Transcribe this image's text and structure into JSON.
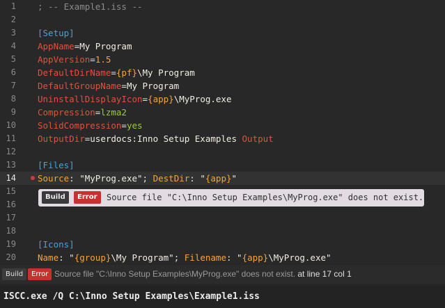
{
  "editor": {
    "lines": [
      {
        "num": "1",
        "tokens": [
          {
            "t": "; -- Example1.iss --",
            "c": "comment"
          }
        ]
      },
      {
        "num": "2",
        "tokens": []
      },
      {
        "num": "3",
        "tokens": [
          {
            "t": "[Setup]",
            "c": "section"
          }
        ]
      },
      {
        "num": "4",
        "tokens": [
          {
            "t": "AppName",
            "c": "key"
          },
          {
            "t": "=",
            "c": "op"
          },
          {
            "t": "My Program",
            "c": "val"
          }
        ]
      },
      {
        "num": "5",
        "tokens": [
          {
            "t": "AppVersion",
            "c": "key"
          },
          {
            "t": "=",
            "c": "op"
          },
          {
            "t": "1.5",
            "c": "num"
          }
        ]
      },
      {
        "num": "6",
        "tokens": [
          {
            "t": "DefaultDirName",
            "c": "key"
          },
          {
            "t": "=",
            "c": "op"
          },
          {
            "t": "{pf}",
            "c": "const"
          },
          {
            "t": "\\My Program",
            "c": "val"
          }
        ]
      },
      {
        "num": "7",
        "tokens": [
          {
            "t": "DefaultGroupName",
            "c": "key"
          },
          {
            "t": "=",
            "c": "op"
          },
          {
            "t": "My Program",
            "c": "val"
          }
        ]
      },
      {
        "num": "8",
        "tokens": [
          {
            "t": "UninstallDisplayIcon",
            "c": "key"
          },
          {
            "t": "=",
            "c": "op"
          },
          {
            "t": "{app}",
            "c": "const"
          },
          {
            "t": "\\MyProg.exe",
            "c": "val"
          }
        ]
      },
      {
        "num": "9",
        "tokens": [
          {
            "t": "Compression",
            "c": "key"
          },
          {
            "t": "=",
            "c": "op"
          },
          {
            "t": "lzma2",
            "c": "green"
          }
        ]
      },
      {
        "num": "10",
        "tokens": [
          {
            "t": "SolidCompression",
            "c": "key"
          },
          {
            "t": "=",
            "c": "op"
          },
          {
            "t": "yes",
            "c": "green"
          }
        ]
      },
      {
        "num": "11",
        "tokens": [
          {
            "t": "OutputDir",
            "c": "key"
          },
          {
            "t": "=",
            "c": "op"
          },
          {
            "t": "userdocs:Inno Setup Examples ",
            "c": "val"
          },
          {
            "t": "Output",
            "c": "key"
          }
        ]
      },
      {
        "num": "12",
        "tokens": []
      },
      {
        "num": "13",
        "tokens": [
          {
            "t": "[Files]",
            "c": "section"
          }
        ]
      },
      {
        "num": "14",
        "current": true,
        "breakpoint": true,
        "tokens": [
          {
            "t": "Source",
            "c": "param"
          },
          {
            "t": ": ",
            "c": "op"
          },
          {
            "t": "\"MyProg.exe\"",
            "c": "str"
          },
          {
            "t": "; ",
            "c": "op"
          },
          {
            "t": "DestDir",
            "c": "param"
          },
          {
            "t": ": ",
            "c": "op"
          },
          {
            "t": "\"",
            "c": "str"
          },
          {
            "t": "{app}",
            "c": "const"
          },
          {
            "t": "\"",
            "c": "str"
          }
        ]
      },
      {
        "num": "15",
        "tokens": []
      },
      {
        "num": "16",
        "tokens": []
      },
      {
        "num": "17",
        "tokens": []
      },
      {
        "num": "18",
        "tokens": []
      },
      {
        "num": "19",
        "tokens": [
          {
            "t": "[Icons]",
            "c": "section"
          }
        ]
      },
      {
        "num": "20",
        "tokens": [
          {
            "t": "Name",
            "c": "param"
          },
          {
            "t": ": ",
            "c": "op"
          },
          {
            "t": "\"",
            "c": "str"
          },
          {
            "t": "{group}",
            "c": "const"
          },
          {
            "t": "\\My Program\"",
            "c": "str"
          },
          {
            "t": "; ",
            "c": "op"
          },
          {
            "t": "Filename",
            "c": "param"
          },
          {
            "t": ": ",
            "c": "op"
          },
          {
            "t": "\"",
            "c": "str"
          },
          {
            "t": "{app}",
            "c": "const"
          },
          {
            "t": "\\MyProg.exe\"",
            "c": "str"
          }
        ]
      }
    ]
  },
  "tooltip": {
    "build_label": "Build",
    "error_label": "Error",
    "message": "Source file \"C:\\Inno Setup Examples\\MyProg.exe\" does not exist."
  },
  "status": {
    "build_label": "Build",
    "error_label": "Error",
    "message": "Source file \"C:\\Inno Setup Examples\\MyProg.exe\" does not exist.",
    "location": " at line 17 col 1"
  },
  "command": {
    "text": "ISCC.exe /Q C:\\Inno Setup Examples\\Example1.iss"
  },
  "colors": {
    "background": "#282828",
    "error_red": "#c8312e",
    "keyword_red": "#e4503b",
    "section_blue": "#3ea6e0",
    "constant_orange": "#f6a43a",
    "value_green": "#9ccc35"
  }
}
